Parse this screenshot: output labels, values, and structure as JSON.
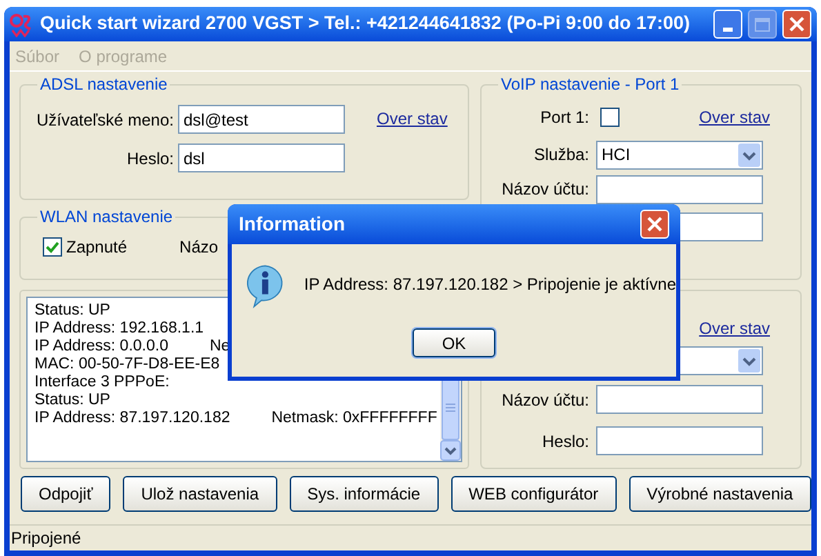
{
  "window": {
    "title": "Quick start wizard 2700 VGST > Tel.: +421244641832 (Po-Pi 9:00 do 17:00)"
  },
  "menu": [
    {
      "label": "Súbor",
      "disabled": true
    },
    {
      "label": "O programe",
      "disabled": true
    }
  ],
  "adsl": {
    "title": "ADSL nastavenie",
    "link": "Over stav",
    "fields": [
      {
        "label": "Užívateľské meno:",
        "value": "dsl@test"
      },
      {
        "label": "Heslo:",
        "value": "dsl"
      }
    ]
  },
  "voip_port1": {
    "title": "VoIP nastavenie - Port 1",
    "port_label": "Port 1:",
    "port_checked": false,
    "link": "Over stav",
    "service_label": "Služba:",
    "service_value": "HCI",
    "account_label": "Názov účtu:"
  },
  "wlan": {
    "title": "WLAN nastavenie",
    "enabled_label": "Zapnuté",
    "enabled_checked": true,
    "name_label": "Názo"
  },
  "log": {
    "lines": [
      {
        "text": "Status: UP"
      },
      {
        "text": "IP Address: 192.168.1.1"
      },
      {
        "text": "IP Address: 0.0.0.0",
        "extra": "Ne"
      },
      {
        "text": "MAC: 00-50-7F-D8-EE-E8"
      },
      {
        "text": "Interface 3 PPPoE:"
      },
      {
        "text": "Status: UP"
      },
      {
        "text": "IP Address: 87.197.120.182",
        "extra": "Netmask: 0xFFFFFFFF"
      }
    ]
  },
  "voip_port2": {
    "link": "Over stav",
    "account_label": "Názov účtu:",
    "password_label": "Heslo:"
  },
  "buttons": [
    "Odpojiť",
    "Ulož nastavenia",
    "Sys. informácie",
    "WEB configurátor",
    "Výrobné nastavenia"
  ],
  "status_bar": "Pripojené",
  "dialog": {
    "title": "Information",
    "message": "IP Address: 87.197.120.182 > Pripojenie je aktívne",
    "button": "OK"
  }
}
